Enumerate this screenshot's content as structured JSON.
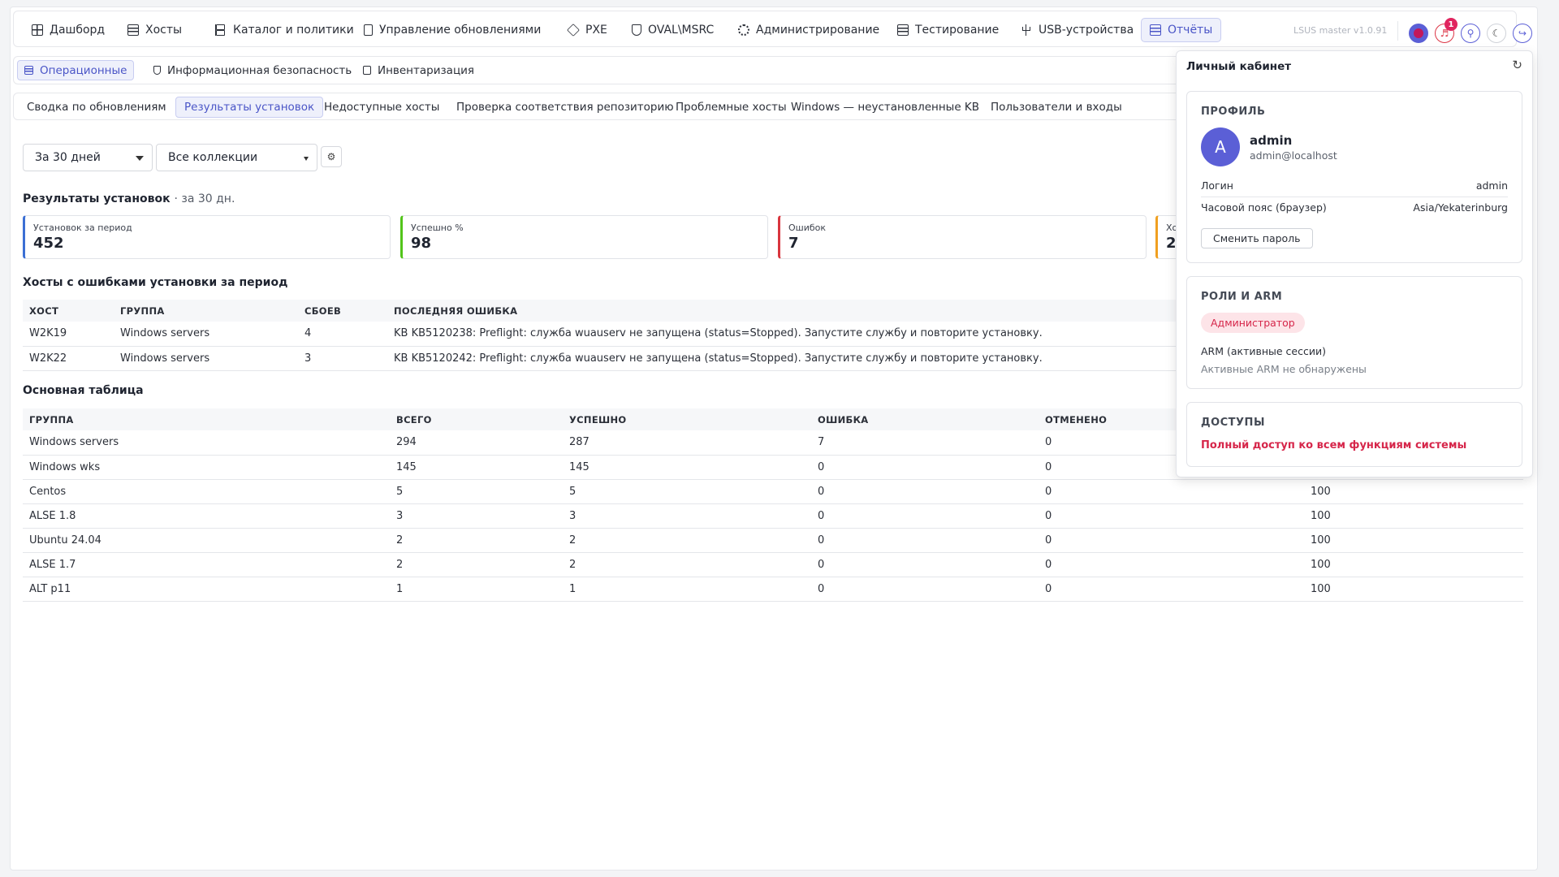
{
  "nav": {
    "items": [
      {
        "label": "Дашборд",
        "icon": "grid-icon"
      },
      {
        "label": "Хосты",
        "icon": "server-icon"
      },
      {
        "label": "Каталог и политики",
        "icon": "tree-icon"
      },
      {
        "label": "Управление обновлениями",
        "icon": "document-icon"
      },
      {
        "label": "PXE",
        "icon": "cube-icon"
      },
      {
        "label": "OVAL\\MSRC",
        "icon": "shield-icon"
      },
      {
        "label": "Администрирование",
        "icon": "gear-icon"
      },
      {
        "label": "Тестирование",
        "icon": "checklist-icon"
      },
      {
        "label": "USB-устройства",
        "icon": "usb-icon"
      },
      {
        "label": "Отчёты",
        "icon": "report-icon"
      }
    ],
    "version": "LSUS master v1.0.91",
    "notification_count": "1"
  },
  "subnav": {
    "items": [
      {
        "label": "Операционные"
      },
      {
        "label": "Информационная безопасность"
      },
      {
        "label": "Инвентаризация"
      }
    ]
  },
  "report_tabs": [
    "Сводка по обновлениям",
    "Результаты установок",
    "Недоступные хосты",
    "Проверка соответствия репозиторию",
    "Проблемные хосты",
    "Windows — неустановленные KB",
    "Пользователи и входы"
  ],
  "filters": {
    "period": "За 30 дней",
    "collection": "Все коллекции"
  },
  "report": {
    "title": "Результаты установок",
    "subtitle": "· за 30 дн."
  },
  "kpis": [
    {
      "label": "Установок за период",
      "value": "452",
      "color": "#3b6fd4"
    },
    {
      "label": "Успешно %",
      "value": "98",
      "color": "#52c41a"
    },
    {
      "label": "Ошибок",
      "value": "7",
      "color": "#d9363e"
    },
    {
      "label": "Хо",
      "value": "2",
      "color": "#f0a020"
    }
  ],
  "errors_section": {
    "title": "Хосты с ошибками установки за период",
    "headers": [
      "ХОСТ",
      "ГРУППА",
      "СБОЕВ",
      "ПОСЛЕДНЯЯ ОШИБКА"
    ],
    "rows": [
      [
        "W2K19",
        "Windows servers",
        "4",
        "KB KB5120238: Preflight: служба wuauserv не запущена (status=Stopped). Запустите службу и повторите установку."
      ],
      [
        "W2K22",
        "Windows servers",
        "3",
        "KB KB5120242: Preflight: служба wuauserv не запущена (status=Stopped). Запустите службу и повторите установку."
      ]
    ]
  },
  "main_table": {
    "title": "Основная таблица",
    "headers": [
      "ГРУППА",
      "ВСЕГО",
      "УСПЕШНО",
      "ОШИБКА",
      "ОТМЕНЕНО",
      ""
    ],
    "rows": [
      [
        "Windows servers",
        "294",
        "287",
        "7",
        "0",
        ""
      ],
      [
        "Windows wks",
        "145",
        "145",
        "0",
        "0",
        ""
      ],
      [
        "Centos",
        "5",
        "5",
        "0",
        "0",
        "100"
      ],
      [
        "ALSE 1.8",
        "3",
        "3",
        "0",
        "0",
        "100"
      ],
      [
        "Ubuntu 24.04",
        "2",
        "2",
        "0",
        "0",
        "100"
      ],
      [
        "ALSE 1.7",
        "2",
        "2",
        "0",
        "0",
        "100"
      ],
      [
        "ALT p11",
        "1",
        "1",
        "0",
        "0",
        "100"
      ]
    ]
  },
  "profile_popover": {
    "title": "Личный кабинет",
    "profile": {
      "heading": "ПРОФИЛЬ",
      "avatar_letter": "A",
      "name": "admin",
      "email": "admin@localhost",
      "login_label": "Логин",
      "login_value": "admin",
      "tz_label": "Часовой пояс (браузер)",
      "tz_value": "Asia/Yekaterinburg",
      "change_password": "Сменить пароль"
    },
    "roles": {
      "heading": "РОЛИ И ARM",
      "role": "Администратор",
      "arm_label": "ARM (активные сессии)",
      "arm_empty": "Активные ARM не обнаружены"
    },
    "access": {
      "heading": "ДОСТУПЫ",
      "text": "Полный доступ ко всем функциям системы"
    }
  }
}
